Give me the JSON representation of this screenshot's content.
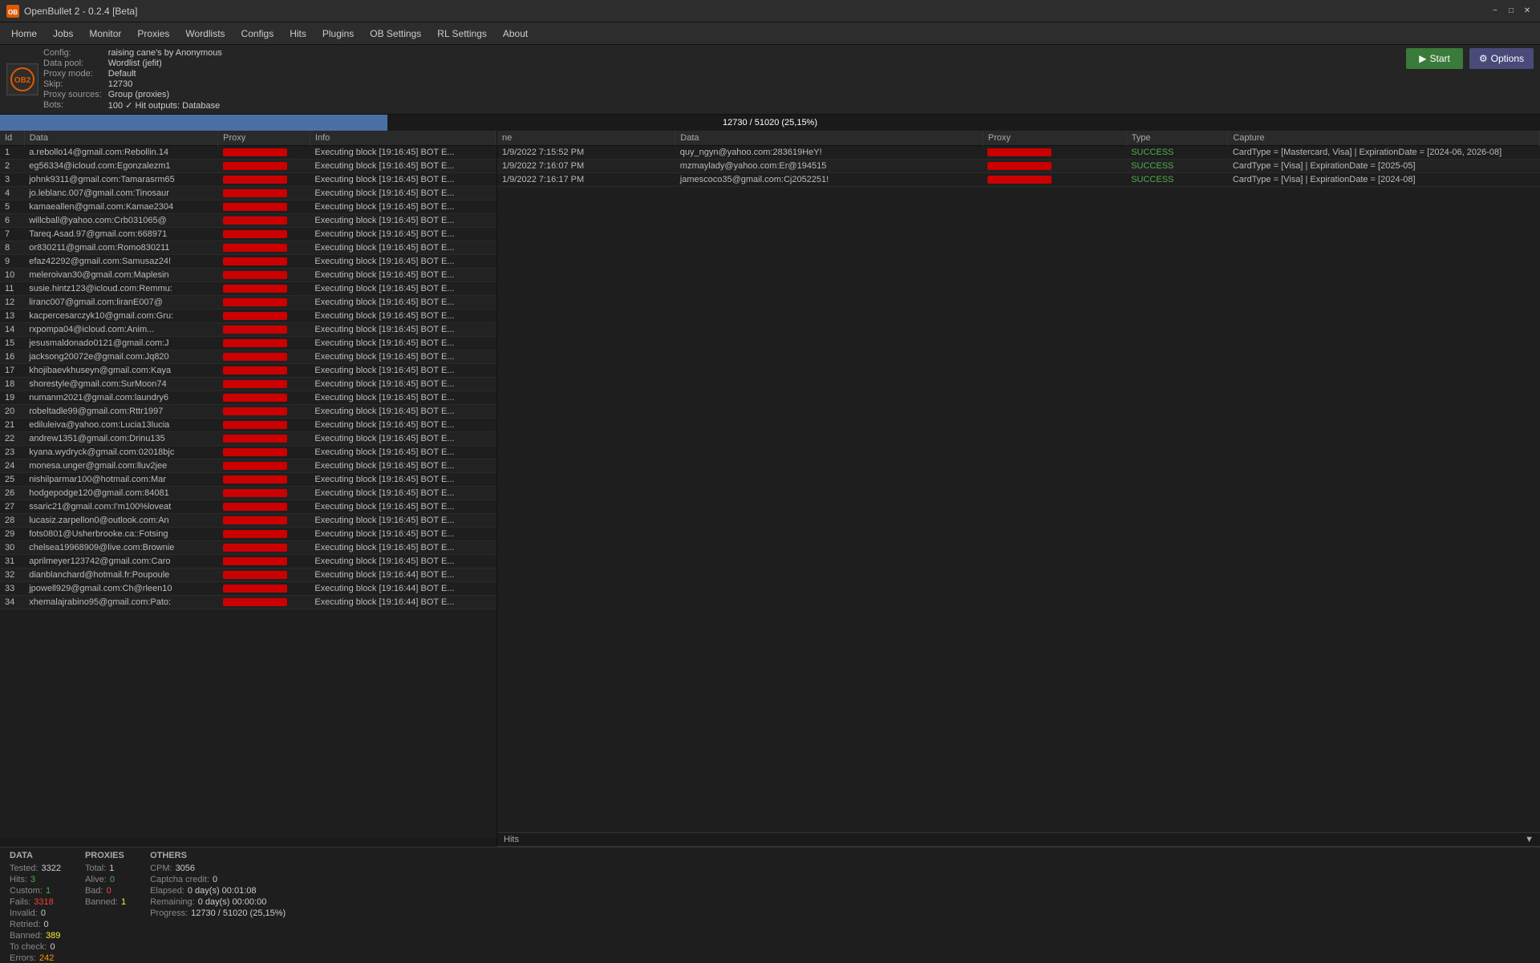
{
  "titleBar": {
    "icon": "OB",
    "title": "OpenBullet 2 - 0.2.4 [Beta]"
  },
  "menuBar": {
    "items": [
      "Home",
      "Jobs",
      "Monitor",
      "Proxies",
      "Wordlists",
      "Configs",
      "Hits",
      "Plugins",
      "OB Settings",
      "RL Settings",
      "About"
    ]
  },
  "configBar": {
    "config_label": "Config:",
    "config_value": "raising cane's by Anonymous",
    "datapool_label": "Data pool:",
    "datapool_value": "Wordlist (jefit)",
    "proxymode_label": "Proxy mode:",
    "proxymode_value": "Default",
    "skip_label": "Skip:",
    "skip_value": "12730",
    "proxysources_label": "Proxy sources:",
    "proxysources_value": "Group (proxies)",
    "bots_label": "Bots:",
    "bots_value": "100",
    "hitoutputs_label": "Hit outputs:",
    "hitoutputs_value": "Database",
    "start_label": "Start",
    "options_label": "Options"
  },
  "progressBar": {
    "text": "12730 / 51020 (25,15%)",
    "percent": 25.15
  },
  "botsTable": {
    "columns": [
      "Id",
      "Data",
      "Proxy",
      "Info"
    ],
    "rows": [
      {
        "id": "1",
        "data": "a.rebollo14@gmail.com:Rebollin.14",
        "proxy": "REDACTED",
        "info": "Executing block [19:16:45] BOT E..."
      },
      {
        "id": "2",
        "data": "eg56334@icloud.com:Egonzalezm1",
        "proxy": "REDACTED",
        "info": "Executing block [19:16:45] BOT E..."
      },
      {
        "id": "3",
        "data": "johnk9311@gmail.com:Tamarasrm65",
        "proxy": "REDACTED",
        "info": "Executing block [19:16:45] BOT E..."
      },
      {
        "id": "4",
        "data": "jo.leblanc.007@gmail.com:Tinosaur",
        "proxy": "REDACTED",
        "info": "Executing block [19:16:45] BOT E..."
      },
      {
        "id": "5",
        "data": "kamaeallen@gmail.com:Kamae2304",
        "proxy": "REDACTED",
        "info": "Executing block [19:16:45] BOT E..."
      },
      {
        "id": "6",
        "data": "willcball@yahoo.com:Crb031065@",
        "proxy": "REDACTED",
        "info": "Executing block [19:16:45] BOT E..."
      },
      {
        "id": "7",
        "data": "Tareq.Asad.97@gmail.com:668971",
        "proxy": "REDACTED",
        "info": "Executing block [19:16:45] BOT E..."
      },
      {
        "id": "8",
        "data": "or830211@gmail.com:Romo830211",
        "proxy": "REDACTED",
        "info": "Executing block [19:16:45] BOT E..."
      },
      {
        "id": "9",
        "data": "efaz42292@gmail.com:Samusaz24!",
        "proxy": "REDACTED",
        "info": "Executing block [19:16:45] BOT E..."
      },
      {
        "id": "10",
        "data": "meleroivan30@gmail.com:Maplesin",
        "proxy": "REDACTED",
        "info": "Executing block [19:16:45] BOT E..."
      },
      {
        "id": "11",
        "data": "susie.hintz123@icloud.com:Remmu:",
        "proxy": "REDACTED",
        "info": "Executing block [19:16:45] BOT E..."
      },
      {
        "id": "12",
        "data": "liranc007@gmail.com:liranE007@",
        "proxy": "REDACTED",
        "info": "Executing block [19:16:45] BOT E..."
      },
      {
        "id": "13",
        "data": "kacpercesarczyk10@gmail.com:Gru:",
        "proxy": "REDACTED",
        "info": "Executing block [19:16:45] BOT E..."
      },
      {
        "id": "14",
        "data": "rxpompa04@icloud.com:Anim...",
        "proxy": "REDACTED",
        "info": "Executing block [19:16:45] BOT E..."
      },
      {
        "id": "15",
        "data": "jesusmaldonado0121@gmail.com:J",
        "proxy": "REDACTED",
        "info": "Executing block [19:16:45] BOT E..."
      },
      {
        "id": "16",
        "data": "jacksong20072e@gmail.com:Jq820",
        "proxy": "REDACTED",
        "info": "Executing block [19:16:45] BOT E..."
      },
      {
        "id": "17",
        "data": "khojibaevkhuseyn@gmail.com:Kaya",
        "proxy": "REDACTED",
        "info": "Executing block [19:16:45] BOT E..."
      },
      {
        "id": "18",
        "data": "shorestyle@gmail.com:SurMoon74",
        "proxy": "REDACTED",
        "info": "Executing block [19:16:45] BOT E..."
      },
      {
        "id": "19",
        "data": "numanm2021@gmail.com:laundry6",
        "proxy": "REDACTED",
        "info": "Executing block [19:16:45] BOT E..."
      },
      {
        "id": "20",
        "data": "robeltadle99@gmail.com:Rttr1997",
        "proxy": "REDACTED",
        "info": "Executing block [19:16:45] BOT E..."
      },
      {
        "id": "21",
        "data": "ediluleiva@yahoo.com:Lucia13lucia",
        "proxy": "REDACTED",
        "info": "Executing block [19:16:45] BOT E..."
      },
      {
        "id": "22",
        "data": "andrew1351@gmail.com:Drinu135",
        "proxy": "REDACTED",
        "info": "Executing block [19:16:45] BOT E..."
      },
      {
        "id": "23",
        "data": "kyana.wydryck@gmail.com:02018bjc",
        "proxy": "REDACTED",
        "info": "Executing block [19:16:45] BOT E..."
      },
      {
        "id": "24",
        "data": "monesa.unger@gmail.com:lluv2jee",
        "proxy": "REDACTED",
        "info": "Executing block [19:16:45] BOT E..."
      },
      {
        "id": "25",
        "data": "nishilparmar100@hotmail.com:Mar",
        "proxy": "REDACTED",
        "info": "Executing block [19:16:45] BOT E..."
      },
      {
        "id": "26",
        "data": "hodgepodge120@gmail.com:84081",
        "proxy": "REDACTED",
        "info": "Executing block [19:16:45] BOT E..."
      },
      {
        "id": "27",
        "data": "ssaric21@gmail.com:I'm100%loveat",
        "proxy": "REDACTED",
        "info": "Executing block [19:16:45] BOT E..."
      },
      {
        "id": "28",
        "data": "lucasiz.zarpellon0@outlook.com:An",
        "proxy": "REDACTED",
        "info": "Executing block [19:16:45] BOT E..."
      },
      {
        "id": "29",
        "data": "fots0801@Usherbrooke.ca::Fotsing",
        "proxy": "REDACTED",
        "info": "Executing block [19:16:45] BOT E..."
      },
      {
        "id": "30",
        "data": "chelsea19968909@live.com:Brownie",
        "proxy": "REDACTED",
        "info": "Executing block [19:16:45] BOT E..."
      },
      {
        "id": "31",
        "data": "aprilmeyer123742@gmail.com:Caro",
        "proxy": "REDACTED",
        "info": "Executing block [19:16:45] BOT E..."
      },
      {
        "id": "32",
        "data": "dianblanchard@hotmail.fr:Poupoule",
        "proxy": "REDACTED",
        "info": "Executing block [19:16:44] BOT E..."
      },
      {
        "id": "33",
        "data": "jpowell929@gmail.com:Ch@rleen10",
        "proxy": "REDACTED",
        "info": "Executing block [19:16:44] BOT E..."
      },
      {
        "id": "34",
        "data": "xhemalajrabino95@gmail.com:Pato:",
        "proxy": "REDACTED",
        "info": "Executing block [19:16:44] BOT E..."
      }
    ]
  },
  "hitsTable": {
    "columns": [
      "ne",
      "Data",
      "Proxy",
      "Type",
      "Capture"
    ],
    "rows": [
      {
        "ne": "1/9/2022 7:15:52 PM",
        "data": "quy_ngyn@yahoo.com:283619HeY!",
        "proxy": "REDACTED",
        "type": "SUCCESS",
        "capture": "CardType = [Mastercard, Visa] | ExpirationDate = [2024-06, 2026-08]"
      },
      {
        "ne": "1/9/2022 7:16:07 PM",
        "data": "mzmaylady@yahoo.com:Er@194515",
        "proxy": "REDACTED",
        "type": "SUCCESS",
        "capture": "CardType = [Visa] | ExpirationDate = [2025-05]"
      },
      {
        "ne": "1/9/2022 7:16:17 PM",
        "data": "jamescoco35@gmail.com:Cj2052251!",
        "proxy": "REDACTED",
        "type": "SUCCESS",
        "capture": "CardType = [Visa] | ExpirationDate = [2024-08]"
      }
    ]
  },
  "hitsLabel": "Hits",
  "stats": {
    "data": {
      "title": "DATA",
      "tested_label": "Tested:",
      "tested_value": "3322",
      "hits_label": "Hits:",
      "hits_value": "3",
      "custom_label": "Custom:",
      "custom_value": "1",
      "fails_label": "Fails:",
      "fails_value": "3318",
      "invalid_label": "Invalid:",
      "invalid_value": "0",
      "retried_label": "Retried:",
      "retried_value": "0",
      "banned_label": "Banned:",
      "banned_value": "389",
      "tocheck_label": "To check:",
      "tocheck_value": "0",
      "errors_label": "Errors:",
      "errors_value": "242"
    },
    "proxies": {
      "title": "PROXIES",
      "total_label": "Total:",
      "total_value": "1",
      "alive_label": "Alive:",
      "alive_value": "0",
      "bad_label": "Bad:",
      "bad_value": "0",
      "banned_label": "Banned:",
      "banned_value": "1"
    },
    "others": {
      "title": "OTHERS",
      "cpm_label": "CPM:",
      "cpm_value": "3056",
      "captcha_label": "Captcha credit:",
      "captcha_value": "0",
      "elapsed_label": "Elapsed:",
      "elapsed_value": "0 day(s) 00:01:08",
      "remaining_label": "Remaining:",
      "remaining_value": "0 day(s) 00:00:00",
      "progress_label": "Progress:",
      "progress_value": "12730 / 51020 (25,15%)"
    }
  }
}
